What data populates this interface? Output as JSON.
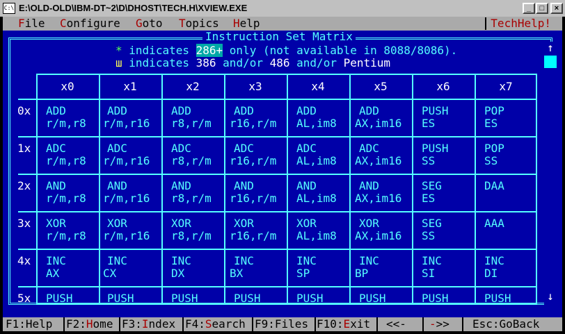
{
  "window": {
    "title": "E:\\OLD-OLD\\IBM-DT~2\\D\\DHOST\\TECH.H\\XVIEW.EXE",
    "icon_label": "C:\\",
    "minimize_glyph": "_",
    "maximize_glyph": "□",
    "close_glyph": "×"
  },
  "menu": {
    "items": [
      {
        "hotkey": "F",
        "rest": "ile"
      },
      {
        "hotkey": "C",
        "rest": "onfigure"
      },
      {
        "hotkey": "G",
        "rest": "oto"
      },
      {
        "hotkey": "T",
        "rest": "opics"
      },
      {
        "hotkey": "H",
        "rest": "elp"
      }
    ],
    "brand": "TechHelp!"
  },
  "panel": {
    "title": "Instruction Set Matrix",
    "legend1": {
      "mark": "*",
      "pre": "indicates",
      "highlight": "286+",
      "post": "only (not available in 8088/8086)."
    },
    "legend2": {
      "mark": "ш",
      "pre": "indicates",
      "a": "386",
      "mid1": "and/or",
      "b": "486",
      "mid2": "and/or",
      "c": "Pentium"
    }
  },
  "matrix": {
    "columns": [
      "x0",
      "x1",
      "x2",
      "x3",
      "x4",
      "x5",
      "x6",
      "x7"
    ],
    "rows": [
      {
        "label": "0x",
        "cells": [
          [
            "ADD",
            "r/m,r8"
          ],
          [
            "ADD",
            "r/m,r16"
          ],
          [
            "ADD",
            "r8,r/m"
          ],
          [
            "ADD",
            "r16,r/m"
          ],
          [
            "ADD",
            "AL,im8"
          ],
          [
            "ADD",
            "AX,im16"
          ],
          [
            "PUSH",
            "ES"
          ],
          [
            "POP",
            "ES"
          ]
        ]
      },
      {
        "label": "1x",
        "cells": [
          [
            "ADC",
            "r/m,r8"
          ],
          [
            "ADC",
            "r/m,r16"
          ],
          [
            "ADC",
            "r8,r/m"
          ],
          [
            "ADC",
            "r16,r/m"
          ],
          [
            "ADC",
            "AL,im8"
          ],
          [
            "ADC",
            "AX,im16"
          ],
          [
            "PUSH",
            "SS"
          ],
          [
            "POP",
            "SS"
          ]
        ]
      },
      {
        "label": "2x",
        "cells": [
          [
            "AND",
            "r/m,r8"
          ],
          [
            "AND",
            "r/m,r16"
          ],
          [
            "AND",
            "r8,r/m"
          ],
          [
            "AND",
            "r16,r/m"
          ],
          [
            "AND",
            "AL,im8"
          ],
          [
            "AND",
            "AX,im16"
          ],
          [
            "SEG",
            "ES"
          ],
          [
            "DAA",
            ""
          ]
        ]
      },
      {
        "label": "3x",
        "cells": [
          [
            "XOR",
            "r/m,r8"
          ],
          [
            "XOR",
            "r/m,r16"
          ],
          [
            "XOR",
            "r8,r/m"
          ],
          [
            "XOR",
            "r16,r/m"
          ],
          [
            "XOR",
            "AL,im8"
          ],
          [
            "XOR",
            "AX,im16"
          ],
          [
            "SEG",
            "SS"
          ],
          [
            "AAA",
            ""
          ]
        ]
      },
      {
        "label": "4x",
        "cells": [
          [
            "INC",
            "AX"
          ],
          [
            "INC",
            "CX"
          ],
          [
            "INC",
            "DX"
          ],
          [
            "INC",
            "BX"
          ],
          [
            "INC",
            "SP"
          ],
          [
            "INC",
            "BP"
          ],
          [
            "INC",
            "SI"
          ],
          [
            "INC",
            "DI"
          ]
        ]
      },
      {
        "label": "5x",
        "cells": [
          [
            "PUSH",
            ""
          ],
          [
            "PUSH",
            ""
          ],
          [
            "PUSH",
            ""
          ],
          [
            "PUSH",
            ""
          ],
          [
            "PUSH",
            ""
          ],
          [
            "PUSH",
            ""
          ],
          [
            "PUSH",
            ""
          ],
          [
            "PUSH",
            ""
          ]
        ]
      }
    ]
  },
  "scrollbar": {
    "up_glyph": "↑",
    "down_glyph": "↓"
  },
  "status": {
    "items": [
      {
        "key": "F1",
        "sep": ":",
        "hotkey": "",
        "rest": "Help"
      },
      {
        "key": "F2",
        "sep": ":",
        "hotkey": "H",
        "rest": "ome"
      },
      {
        "key": "F3",
        "sep": ":",
        "hotkey": "I",
        "rest": "ndex"
      },
      {
        "key": "F4",
        "sep": ":",
        "hotkey": "S",
        "rest": "earch"
      },
      {
        "key": "F9",
        "sep": ":",
        "hotkey": "",
        "rest": "Files"
      },
      {
        "key": "F10",
        "sep": ":",
        "hotkey": "E",
        "rest": "xit"
      },
      {
        "key": "<<-",
        "sep": "",
        "hotkey": "",
        "rest": ""
      },
      {
        "key": "",
        "sep": "",
        "hotkey": "-",
        "rest": ">>"
      },
      {
        "key": "Esc:GoBack",
        "sep": "",
        "hotkey": "",
        "rest": ""
      }
    ]
  }
}
